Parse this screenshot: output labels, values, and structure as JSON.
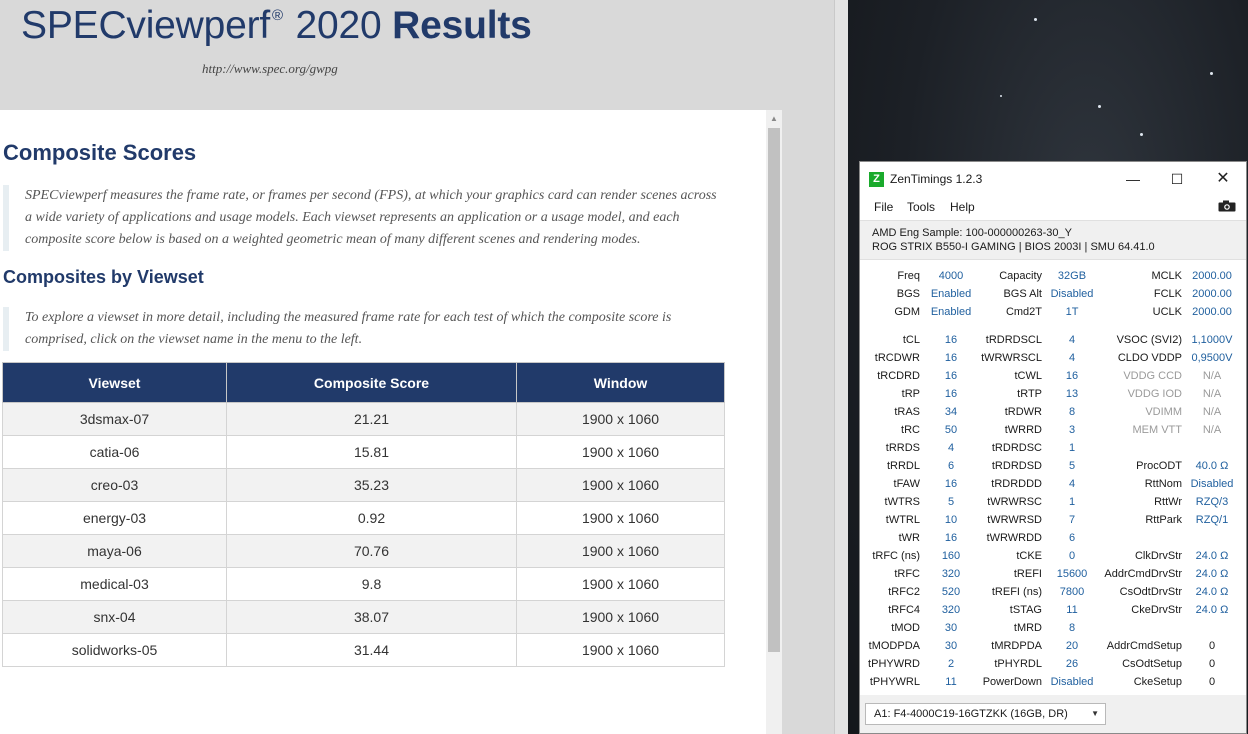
{
  "spec": {
    "title_main": "SPECviewperf",
    "title_reg": "®",
    "title_year": " 2020 ",
    "title_bold": "Results",
    "url": "http://www.spec.org/gwpg",
    "composite_heading": "Composite Scores",
    "intro_text": "SPECviewperf measures the frame rate, or frames per second (FPS), at which your graphics card can render scenes across a wide variety of applications and usage models. Each viewset represents an application or a usage model, and each composite score below is based on a weighted geometric mean of many different scenes and rendering modes.",
    "viewset_heading": "Composites by Viewset",
    "explore_text": "To explore a viewset in more detail, including the measured frame rate for each test of which the composite score is comprised, click on the viewset name in the menu to the left.",
    "table": {
      "headers": [
        "Viewset",
        "Composite Score",
        "Window"
      ],
      "rows": [
        [
          "3dsmax-07",
          "21.21",
          "1900 x 1060"
        ],
        [
          "catia-06",
          "15.81",
          "1900 x 1060"
        ],
        [
          "creo-03",
          "35.23",
          "1900 x 1060"
        ],
        [
          "energy-03",
          "0.92",
          "1900 x 1060"
        ],
        [
          "maya-06",
          "70.76",
          "1900 x 1060"
        ],
        [
          "medical-03",
          "9.8",
          "1900 x 1060"
        ],
        [
          "snx-04",
          "38.07",
          "1900 x 1060"
        ],
        [
          "solidworks-05",
          "31.44",
          "1900 x 1060"
        ]
      ]
    }
  },
  "zen": {
    "logo": "Z",
    "title": "ZenTimings 1.2.3",
    "menu": [
      "File",
      "Tools",
      "Help"
    ],
    "cpu_line": "AMD Eng Sample: 100-000000263-30_Y",
    "board_line": "ROG STRIX B550-I GAMING | BIOS 2003I | SMU 64.41.0",
    "top": [
      [
        "Freq",
        "4000",
        "Capacity",
        "32GB",
        "MCLK",
        "2000.00"
      ],
      [
        "BGS",
        "Enabled",
        "BGS Alt",
        "Disabled",
        "FCLK",
        "2000.00"
      ],
      [
        "GDM",
        "Enabled",
        "Cmd2T",
        "1T",
        "UCLK",
        "2000.00"
      ]
    ],
    "timings": [
      [
        "tCL",
        "16",
        "tRDRDSCL",
        "4",
        "VSOC (SVI2)",
        "1,1000V"
      ],
      [
        "tRCDWR",
        "16",
        "tWRWRSCL",
        "4",
        "CLDO VDDP",
        "0,9500V"
      ],
      [
        "tRCDRD",
        "16",
        "tCWL",
        "16",
        "VDDG CCD",
        "N/A"
      ],
      [
        "tRP",
        "16",
        "tRTP",
        "13",
        "VDDG IOD",
        "N/A"
      ],
      [
        "tRAS",
        "34",
        "tRDWR",
        "8",
        "VDIMM",
        "N/A"
      ],
      [
        "tRC",
        "50",
        "tWRRD",
        "3",
        "MEM VTT",
        "N/A"
      ],
      [
        "tRRDS",
        "4",
        "tRDRDSC",
        "1",
        "",
        ""
      ],
      [
        "tRRDL",
        "6",
        "tRDRDSD",
        "5",
        "ProcODT",
        "40.0 Ω"
      ],
      [
        "tFAW",
        "16",
        "tRDRDDD",
        "4",
        "RttNom",
        "Disabled"
      ],
      [
        "tWTRS",
        "5",
        "tWRWRSC",
        "1",
        "RttWr",
        "RZQ/3"
      ],
      [
        "tWTRL",
        "10",
        "tWRWRSD",
        "7",
        "RttPark",
        "RZQ/1"
      ],
      [
        "tWR",
        "16",
        "tWRWRDD",
        "6",
        "",
        ""
      ],
      [
        "tRFC (ns)",
        "160",
        "tCKE",
        "0",
        "ClkDrvStr",
        "24.0 Ω"
      ],
      [
        "tRFC",
        "320",
        "tREFI",
        "15600",
        "AddrCmdDrvStr",
        "24.0 Ω"
      ],
      [
        "tRFC2",
        "520",
        "tREFI (ns)",
        "7800",
        "CsOdtDrvStr",
        "24.0 Ω"
      ],
      [
        "tRFC4",
        "320",
        "tSTAG",
        "11",
        "CkeDrvStr",
        "24.0 Ω"
      ],
      [
        "tMOD",
        "30",
        "tMRD",
        "8",
        "",
        ""
      ],
      [
        "tMODPDA",
        "30",
        "tMRDPDA",
        "20",
        "AddrCmdSetup",
        "0"
      ],
      [
        "tPHYWRD",
        "2",
        "tPHYRDL",
        "26",
        "CsOdtSetup",
        "0"
      ],
      [
        "tPHYWRL",
        "11",
        "PowerDown",
        "Disabled",
        "CkeSetup",
        "0"
      ]
    ],
    "dimm": "A1: F4-4000C19-16GTZKK (16GB, DR)"
  }
}
